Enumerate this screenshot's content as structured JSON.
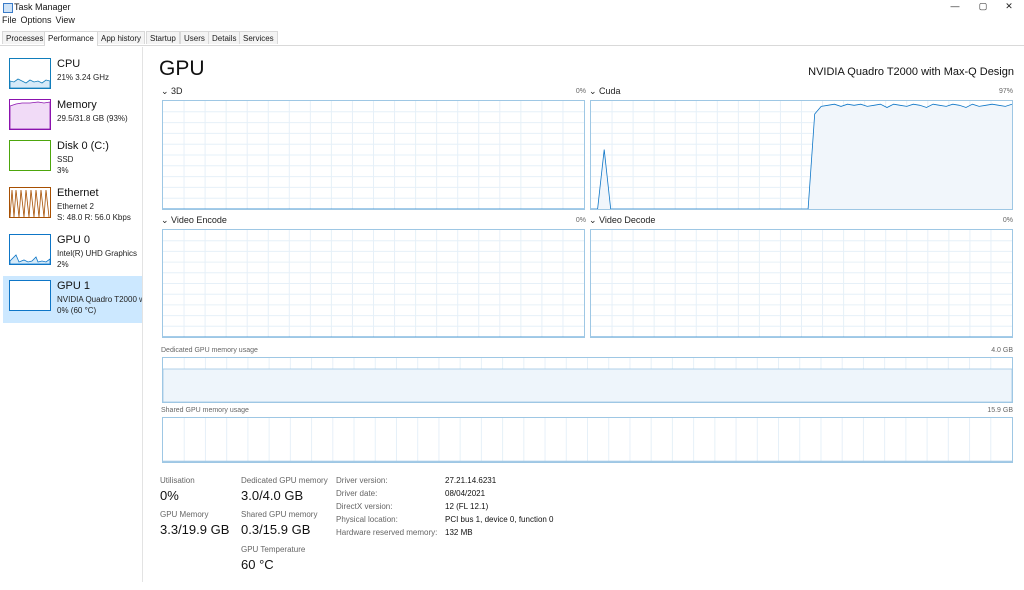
{
  "window": {
    "title": "Task Manager",
    "controls": [
      "—",
      "▢",
      "✕"
    ]
  },
  "menu": [
    "File",
    "Options",
    "View"
  ],
  "tabs": [
    "Processes",
    "Performance",
    "App history",
    "Startup",
    "Users",
    "Details",
    "Services"
  ],
  "active_tab": "Performance",
  "sidebar": {
    "items": [
      {
        "title": "CPU",
        "line1": "21%  3.24 GHz",
        "line2": ""
      },
      {
        "title": "Memory",
        "line1": "29.5/31.8 GB (93%)",
        "line2": ""
      },
      {
        "title": "Disk 0 (C:)",
        "line1": "SSD",
        "line2": "3%"
      },
      {
        "title": "Ethernet",
        "line1": "Ethernet 2",
        "line2": "S: 48.0  R: 56.0 Kbps"
      },
      {
        "title": "GPU 0",
        "line1": "Intel(R) UHD Graphics",
        "line2": "2%"
      },
      {
        "title": "GPU 1",
        "line1": "NVIDIA Quadro T2000 with Max-Q Design",
        "line2": "0%  (60 °C)"
      }
    ],
    "selected": "GPU 1",
    "colors": {
      "cpu": "#117dbb",
      "memory": "#8b12ae",
      "disk": "#4da60c",
      "ethernet": "#a74f01",
      "gpu": "#0e76c7"
    }
  },
  "main": {
    "title": "GPU",
    "gpu_name": "NVIDIA Quadro T2000 with Max-Q Design",
    "engines": [
      {
        "label": "3D",
        "percent": "0%",
        "values": [
          0,
          0
        ]
      },
      {
        "label": "Cuda",
        "percent": "97%",
        "values": [
          0,
          0,
          55,
          0,
          0,
          0,
          0,
          0,
          0,
          0,
          0,
          0,
          0,
          0,
          0,
          0,
          0,
          0,
          0,
          0,
          0,
          0,
          0,
          0,
          0,
          0,
          0,
          0,
          0,
          0,
          0,
          0,
          0,
          0,
          88,
          95,
          96,
          97,
          95,
          97,
          96,
          97,
          95,
          96,
          97,
          94,
          97,
          96,
          95,
          97,
          96,
          94,
          97,
          96,
          95,
          97,
          96,
          94,
          97,
          95,
          96,
          97,
          96,
          95,
          97
        ]
      },
      {
        "label": "Video Encode",
        "percent": "0%",
        "values": [
          0,
          0
        ]
      },
      {
        "label": "Video Decode",
        "percent": "0%",
        "values": [
          0,
          0
        ]
      }
    ],
    "dedicated": {
      "label": "Dedicated GPU memory usage",
      "max": "4.0 GB",
      "fill_fraction": 0.75
    },
    "shared": {
      "label": "Shared GPU memory usage",
      "max": "15.9 GB",
      "fill_fraction": 0.02
    },
    "stats": {
      "utilisation_label": "Utilisation",
      "utilisation": "0%",
      "gpu_memory_label": "GPU Memory",
      "gpu_memory": "3.3/19.9 GB",
      "dedicated_label": "Dedicated GPU memory",
      "dedicated": "3.0/4.0 GB",
      "shared_label": "Shared GPU memory",
      "shared": "0.3/15.9 GB",
      "temp_label": "GPU Temperature",
      "temp": "60 °C"
    },
    "info": [
      {
        "label": "Driver version:",
        "value": "27.21.14.6231"
      },
      {
        "label": "Driver date:",
        "value": "08/04/2021"
      },
      {
        "label": "DirectX version:",
        "value": "12 (FL 12.1)"
      },
      {
        "label": "Physical location:",
        "value": "PCI bus 1, device 0, function 0"
      },
      {
        "label": "Hardware reserved memory:",
        "value": "132 MB"
      }
    ]
  }
}
